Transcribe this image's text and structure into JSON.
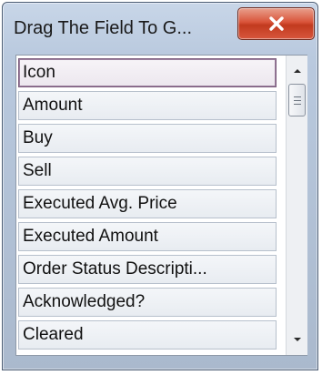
{
  "window": {
    "title": "Drag The Field To G..."
  },
  "fields": [
    {
      "label": "Icon",
      "selected": true
    },
    {
      "label": "Amount"
    },
    {
      "label": "Buy"
    },
    {
      "label": "Sell"
    },
    {
      "label": "Executed Avg. Price"
    },
    {
      "label": "Executed Amount"
    },
    {
      "label": "Order Status Descripti..."
    },
    {
      "label": "Acknowledged?"
    },
    {
      "label": "Cleared"
    }
  ],
  "icons": {
    "close": "close-icon",
    "scroll_up": "arrow-up-icon",
    "scroll_down": "arrow-down-icon",
    "thumb_grip": "grip-icon"
  },
  "colors": {
    "close_button": "#d24a2f",
    "selected_border": "#7b5c7c"
  }
}
